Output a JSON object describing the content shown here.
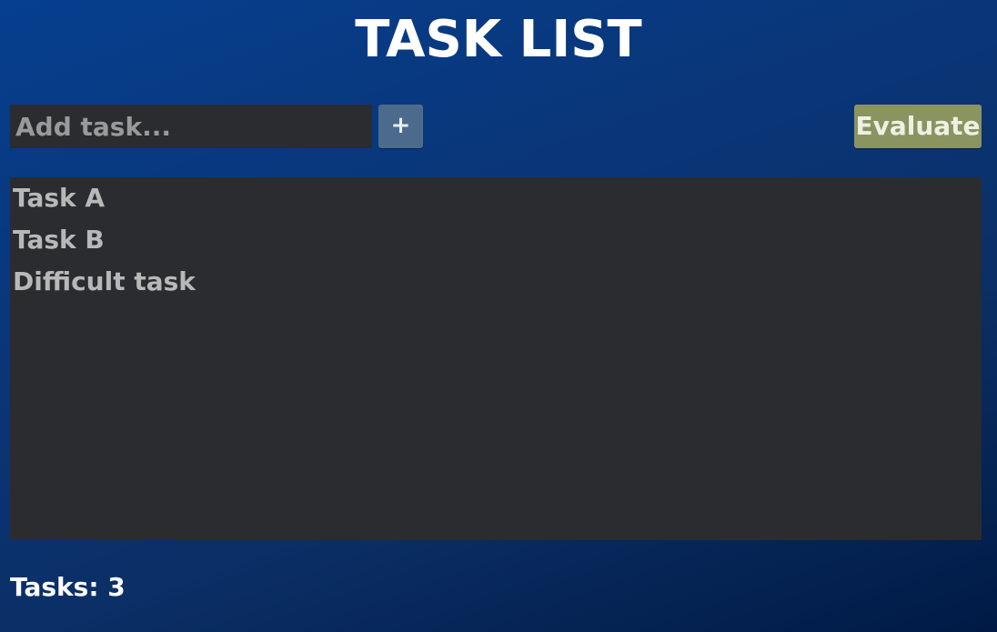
{
  "app": {
    "title": "TASK LIST"
  },
  "toolbar": {
    "input_placeholder": "Add task...",
    "input_value": "",
    "add_label": "+",
    "evaluate_label": "Evaluate"
  },
  "tasks": [
    {
      "label": "Task A"
    },
    {
      "label": "Task B"
    },
    {
      "label": "Difficult task"
    }
  ],
  "footer": {
    "count_label": "Tasks:",
    "count_value": "3"
  },
  "colors": {
    "background_top": "#063f8f",
    "background_bottom": "#001a45",
    "panel": "#2a2c30",
    "add_button": "#4c6b8c",
    "evaluate_button": "#8a9460"
  }
}
